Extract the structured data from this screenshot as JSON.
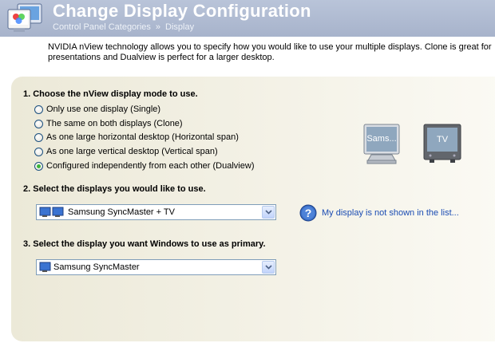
{
  "header": {
    "title": "Change Display Configuration",
    "breadcrumb": [
      "Control Panel Categories",
      "Display"
    ],
    "breadcrumb_separator": "»"
  },
  "description": "NVIDIA nView technology allows you to specify how you would like to use your multiple displays. Clone is great for presentations and Dualview is perfect for a larger desktop.",
  "section1": {
    "title": "1. Choose the nView display mode to use.",
    "options": [
      {
        "label": "Only use one display (Single)",
        "checked": false
      },
      {
        "label": "The same on both displays (Clone)",
        "checked": false
      },
      {
        "label": "As one large horizontal desktop (Horizontal span)",
        "checked": false
      },
      {
        "label": "As one large vertical desktop (Vertical span)",
        "checked": false
      },
      {
        "label": "Configured independently from each other (Dualview)",
        "checked": true
      }
    ]
  },
  "preview": {
    "monitor1_label": "Sams...",
    "monitor2_label": "TV"
  },
  "section2": {
    "title": "2. Select the displays you would like to use.",
    "selected": "Samsung SyncMaster + TV",
    "help_link": "My display is not shown in the list..."
  },
  "section3": {
    "title": "3. Select the display you want Windows to use as primary.",
    "selected": "Samsung SyncMaster"
  },
  "colors": {
    "header_bg": "#b3bfd6",
    "panel_bg": "#ece9d8",
    "link": "#1b4cb3",
    "radio_checked": "#3cb43c"
  }
}
